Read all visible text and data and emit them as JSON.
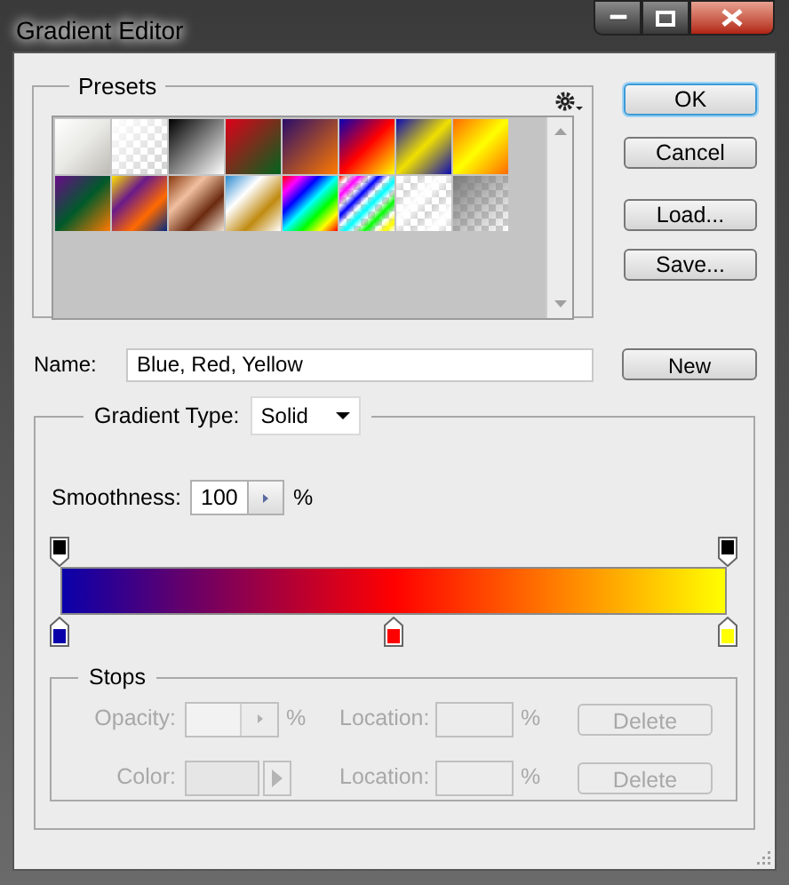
{
  "window": {
    "title": "Gradient Editor"
  },
  "presets": {
    "label": "Presets"
  },
  "buttons": [
    {
      "label": "OK",
      "default": true
    },
    {
      "label": "Cancel",
      "default": false
    },
    {
      "label": "Load...",
      "default": false
    },
    {
      "label": "Save...",
      "default": false
    }
  ],
  "name": {
    "label": "Name:",
    "value": "Blue, Red, Yellow",
    "button": "New"
  },
  "gradient_type": {
    "label": "Gradient Type:",
    "value": "Solid"
  },
  "smoothness": {
    "label": "Smoothness:",
    "value": "100",
    "unit": "%"
  },
  "color_stops": [
    {
      "color": "#0a00aa"
    },
    {
      "color": "#ff0000"
    },
    {
      "color": "#ffff00"
    }
  ],
  "stops": {
    "label": "Stops",
    "rows": [
      {
        "kind": "opacity",
        "label": "Opacity:",
        "unit": "%",
        "location_label": "Location:",
        "location_unit": "%",
        "button": "Delete",
        "disabled": true
      },
      {
        "kind": "color",
        "label": "Color:",
        "location_label": "Location:",
        "location_unit": "%",
        "button": "Delete",
        "disabled": true
      }
    ]
  }
}
